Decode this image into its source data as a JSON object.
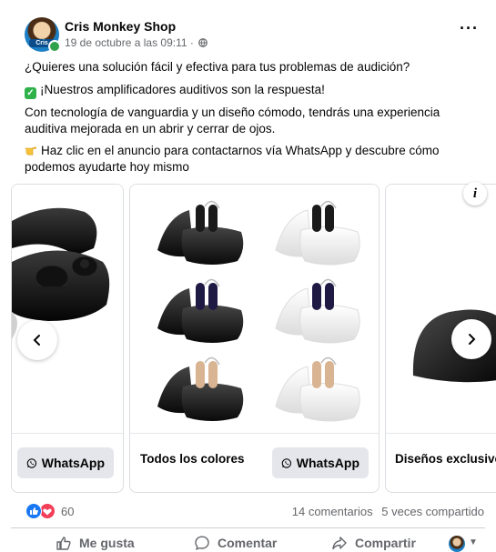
{
  "post": {
    "page_name": "Cris Monkey Shop",
    "avatar_text": "Cris",
    "timestamp": "19 de octubre a las 09:11 ·",
    "line1": "¿Quieres una solución fácil y efectiva para tus problemas de audición?",
    "line2": "¡Nuestros amplificadores auditivos son la respuesta!",
    "line3": "Con tecnología de vanguardia y un diseño cómodo, tendrás una experiencia auditiva mejorada en un abrir y cerrar de ojos.",
    "line4": "Haz clic en el anuncio para contactarnos vía WhatsApp y descubre cómo podemos ayudarte hoy mismo",
    "more_label": "···"
  },
  "carousel": {
    "slides": [
      {
        "caption": "",
        "button": "WhatsApp"
      },
      {
        "caption": "Todos los colores",
        "button": "WhatsApp"
      },
      {
        "caption": "Diseños exclusivos",
        "button": ""
      }
    ],
    "info_label": "i"
  },
  "stats": {
    "reaction_count": "60",
    "comments": "14 comentarios",
    "shares": "5 veces compartido"
  },
  "actions": {
    "like": "Me gusta",
    "comment": "Comentar",
    "share": "Compartir"
  },
  "colors": {
    "like_blue": "#1877f2",
    "love_red": "#f33e58",
    "online_green": "#31a24c",
    "whatsapp_button_bg": "#e4e6eb"
  }
}
